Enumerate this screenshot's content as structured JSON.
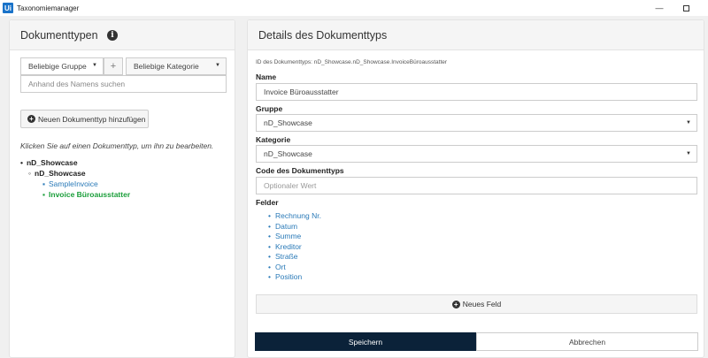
{
  "window": {
    "app_icon": "Ui",
    "title": "Taxonomiemanager",
    "minimize_glyph": "—"
  },
  "left": {
    "title": "Dokumenttypen",
    "info_icon": "i",
    "group_select": "Beliebige Gruppe",
    "plus_label": "+",
    "category_select": "Beliebige Kategorie",
    "search_placeholder": "Anhand des Namens suchen",
    "add_button": "Neuen Dokumenttyp hinzufügen",
    "hint": "Klicken Sie auf einen Dokumenttyp, um ihn zu bearbeiten.",
    "tree": {
      "root": "nD_Showcase",
      "child": "nD_Showcase",
      "leaves": [
        "SampleInvoice",
        "Invoice Büroausstatter"
      ]
    }
  },
  "right": {
    "title": "Details des Dokumenttyps",
    "id_line": "ID des Dokumenttyps: nD_Showcase.nD_Showcase.InvoiceBüroausstatter",
    "name_label": "Name",
    "name_value": "Invoice Büroausstatter",
    "group_label": "Gruppe",
    "group_value": "nD_Showcase",
    "category_label": "Kategorie",
    "category_value": "nD_Showcase",
    "code_label": "Code des Dokumenttyps",
    "code_placeholder": "Optionaler Wert",
    "fields_label": "Felder",
    "fields": [
      "Rechnung Nr.",
      "Datum",
      "Summe",
      "Kreditor",
      "Straße",
      "Ort",
      "Position"
    ],
    "new_field_button": "Neues Feld",
    "save_button": "Speichern",
    "cancel_button": "Abbrechen"
  }
}
